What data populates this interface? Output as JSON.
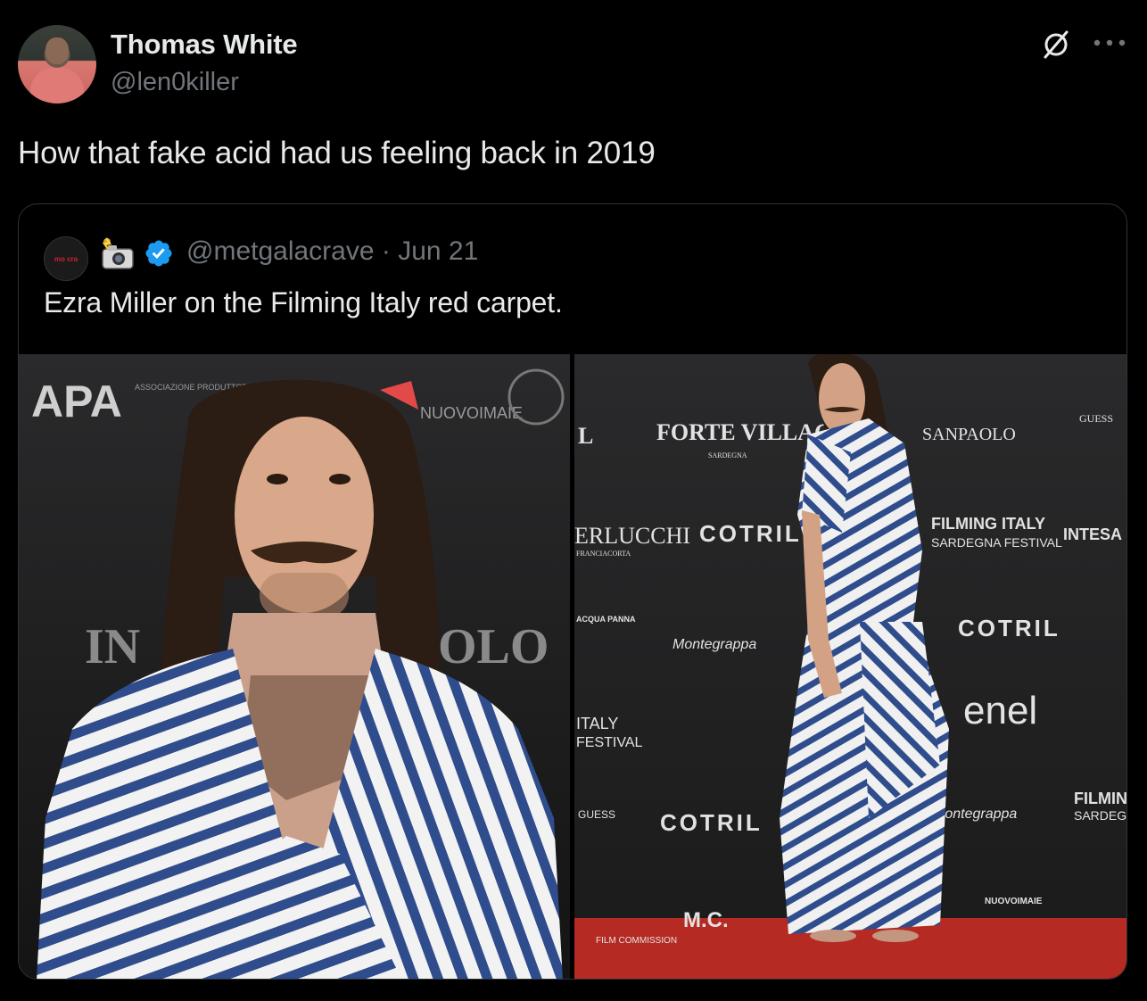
{
  "author": {
    "name": "Thomas White",
    "handle": "@len0killer",
    "avatar_icon": "user-avatar"
  },
  "header_icons": {
    "grok": "grok-icon",
    "more": "more-options-icon"
  },
  "tweet": {
    "text": "How that fake acid had us feeling back in 2019"
  },
  "quoted": {
    "avatar_text": "mo cra",
    "emoji": "camera-flash-icon",
    "verified": "verified-badge-icon",
    "handle_date": "@metgalacrave · Jun 21",
    "text": "Ezra Miller on the Filming Italy red carpet."
  },
  "photos": [
    {
      "id": "left",
      "backdrop_text": [
        "APA",
        "ASSOCIAZIONE PRODUTTORI AUDIOVISIVI",
        "NUOVOIMAIE",
        "IN",
        "OLO"
      ]
    },
    {
      "id": "right",
      "backdrop_text": [
        "L",
        "FORTE VILLAGE",
        "SARDEGNA",
        "SANPAOLO",
        "GUESS",
        "ERLUCCHI",
        "FRANCIACORTA",
        "COTRIL",
        "FILMING ITALY",
        "SARDEGNA FESTIVAL",
        "INTESA",
        "ACQUA PANNA",
        "Montegrappa",
        "ITALY",
        "FESTIVAL",
        "COTRIL",
        "enel",
        "GUESS",
        "COTRIL",
        "Montegrappa",
        "FILMING",
        "SARDEGNA",
        "FILM COMMISSION",
        "M.C.",
        "NUOVOIMAIE"
      ]
    }
  ],
  "colors": {
    "background": "#000000",
    "text_primary": "#e7e9ea",
    "text_secondary": "#71767b",
    "border": "#2f3336",
    "verified": "#1d9bf0",
    "carpet": "#b52a22",
    "stripe": "#2f4c8c"
  }
}
